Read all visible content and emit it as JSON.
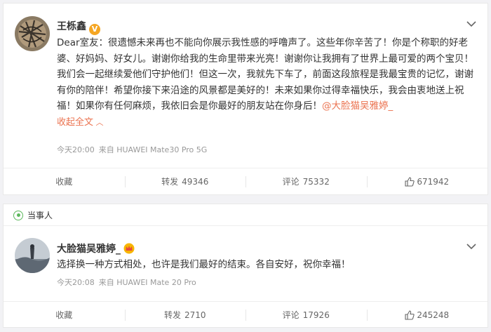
{
  "post1": {
    "author": "王栎鑫",
    "badge": "V",
    "text": "Dear室友：很遗憾未来再也不能向你展示我性感的呼噜声了。这些年你辛苦了！你是个称职的好老婆、好妈妈、好女儿。谢谢你给我的生命里带来光亮！谢谢你让我拥有了世界上最可爱的两个宝贝！我们会一起继续爱他们守护他们！但这一次，我就先下车了，前面这段旅程是我最宝贵的记忆，谢谢有你的陪伴！希望你接下来沿途的风景都是美好的！未来如果你过得幸福快乐，我会由衷地送上祝福！如果你有任何麻烦，我依旧会是你最好的朋友站在你身后！",
    "mention": "@大脸猫吴雅婷_",
    "collapse_label": "收起全文",
    "time": "今天20:00",
    "source": "来自 HUAWEI Mate30 Pro 5G",
    "actions": {
      "fav_label": "收藏",
      "repost_label": "转发",
      "repost_count": "49346",
      "comment_label": "评论",
      "comment_count": "75332",
      "like_count": "671942"
    }
  },
  "post2": {
    "tag": "当事人",
    "author": "大脸猫吴雅婷_",
    "text": "选择换一种方式相处，也许是我们最好的结束。各自安好，祝你幸福！",
    "time": "今天20:08",
    "source": "来自 HUAWEI Mate 20 Pro",
    "actions": {
      "fav_label": "收藏",
      "repost_label": "转发",
      "repost_count": "2710",
      "comment_label": "评论",
      "comment_count": "17926",
      "like_count": "245248"
    }
  },
  "colors": {
    "accent": "#eb7350",
    "badge": "#f5a623",
    "tag_green": "#5cb85c"
  },
  "icons": [
    "chevron-down-icon",
    "verified-badge-icon",
    "crown-badge-icon",
    "thumbs-up-icon",
    "party-tag-icon"
  ]
}
